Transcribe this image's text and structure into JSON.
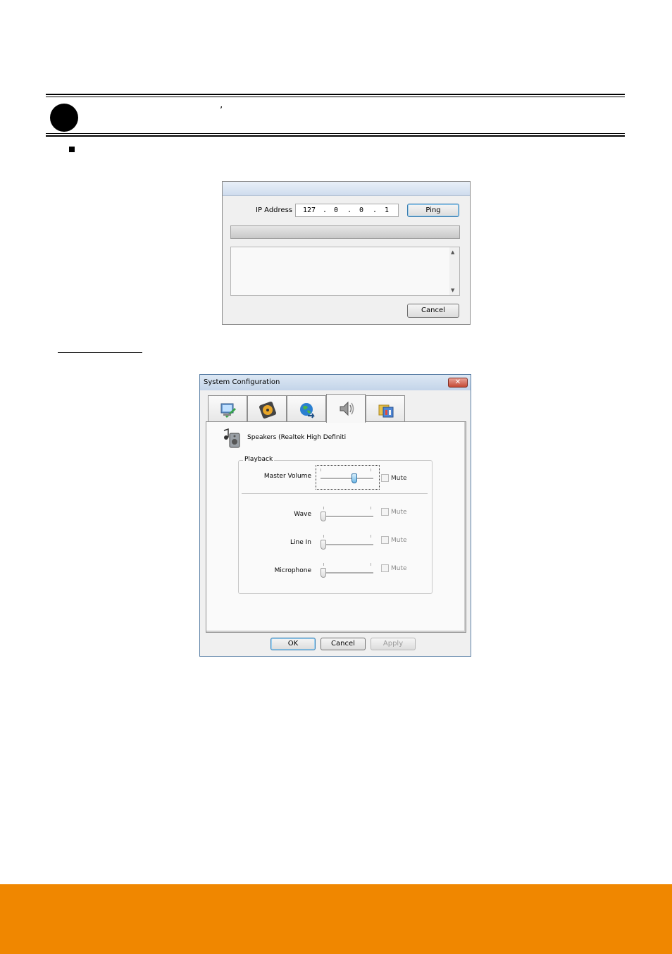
{
  "ping_dialog": {
    "ip_label": "IP Address",
    "ip_octets": [
      "127",
      "0",
      "0",
      "1"
    ],
    "ip_separator": ".",
    "ping_button": "Ping",
    "cancel_button": "Cancel",
    "scroll_up_icon": "scroll-up-arrow",
    "scroll_down_icon": "scroll-down-arrow"
  },
  "system_config": {
    "title": "System Configuration",
    "close_glyph": "✕",
    "tabs": [
      {
        "icon": "system-settings-icon"
      },
      {
        "icon": "hard-disk-icon"
      },
      {
        "icon": "network-globe-icon"
      },
      {
        "icon": "speaker-icon",
        "active": true
      },
      {
        "icon": "folders-icon"
      }
    ],
    "device_name": "Speakers (Realtek High Definiti",
    "playback_group": "Playback",
    "controls": [
      {
        "label": "Master Volume",
        "mute": "Mute",
        "level": 0.65,
        "enabled": true
      },
      {
        "label": "Wave",
        "mute": "Mute",
        "level": 0.0,
        "enabled": false
      },
      {
        "label": "Line In",
        "mute": "Mute",
        "level": 0.0,
        "enabled": false
      },
      {
        "label": "Microphone",
        "mute": "Mute",
        "level": 0.0,
        "enabled": false
      }
    ],
    "ok_button": "OK",
    "cancel_button": "Cancel",
    "apply_button": "Apply"
  },
  "colors": {
    "footer": "#f08700",
    "title_bar": "#c3d4e9",
    "close_button": "#c44a35"
  }
}
